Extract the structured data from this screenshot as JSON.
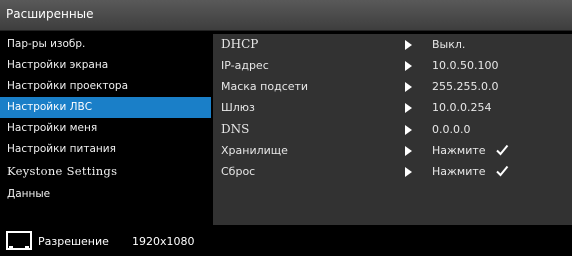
{
  "title": "Расширенные",
  "menu": [
    {
      "label": "Пар-ры изобр."
    },
    {
      "label": "Настройки экрана"
    },
    {
      "label": "Настройки проектора"
    },
    {
      "label": "Настройки ЛВС",
      "selected": true
    },
    {
      "label": "Настройки меня"
    },
    {
      "label": "Настройки питания"
    },
    {
      "label": "Keystone Settings"
    },
    {
      "label": "Данные"
    }
  ],
  "settings": [
    {
      "label": "DHCP",
      "value": "Выкл."
    },
    {
      "label": "IP-адрес",
      "value": "10.0.50.100"
    },
    {
      "label": "Маска подсети",
      "value": "255.255.0.0"
    },
    {
      "label": "Шлюз",
      "value": "10.0.0.254"
    },
    {
      "label": "DNS",
      "value": "0.0.0.0"
    },
    {
      "label": "Хранилище",
      "value": "Нажмите",
      "check": true
    },
    {
      "label": "Сброс",
      "value": "Нажмите",
      "check": true
    }
  ],
  "status": {
    "icon": "resolution-monitor-icon",
    "label": "Разрешение",
    "value": "1920x1080"
  },
  "colors": {
    "selected": "#1a7fc8",
    "panel": "#323232",
    "titlebar": "#4a4a4a"
  }
}
